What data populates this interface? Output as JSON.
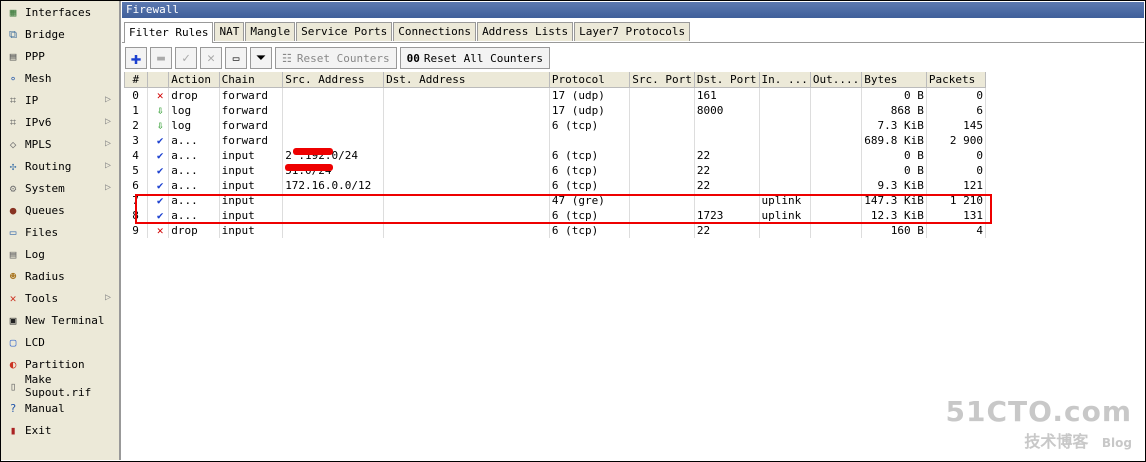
{
  "sidebar": {
    "items": [
      {
        "label": "Interfaces",
        "icon": "interfaces-icon",
        "arrow": false
      },
      {
        "label": "Bridge",
        "icon": "bridge-icon",
        "arrow": false
      },
      {
        "label": "PPP",
        "icon": "ppp-icon",
        "arrow": false
      },
      {
        "label": "Mesh",
        "icon": "mesh-icon",
        "arrow": false
      },
      {
        "label": "IP",
        "icon": "ip-icon",
        "arrow": true
      },
      {
        "label": "IPv6",
        "icon": "ipv6-icon",
        "arrow": true
      },
      {
        "label": "MPLS",
        "icon": "mpls-icon",
        "arrow": true
      },
      {
        "label": "Routing",
        "icon": "routing-icon",
        "arrow": true
      },
      {
        "label": "System",
        "icon": "system-icon",
        "arrow": true
      },
      {
        "label": "Queues",
        "icon": "queues-icon",
        "arrow": false
      },
      {
        "label": "Files",
        "icon": "files-icon",
        "arrow": false
      },
      {
        "label": "Log",
        "icon": "log-icon",
        "arrow": false
      },
      {
        "label": "Radius",
        "icon": "radius-icon",
        "arrow": false
      },
      {
        "label": "Tools",
        "icon": "tools-icon",
        "arrow": true
      },
      {
        "label": "New Terminal",
        "icon": "terminal-icon",
        "arrow": false
      },
      {
        "label": "LCD",
        "icon": "lcd-icon",
        "arrow": false
      },
      {
        "label": "Partition",
        "icon": "partition-icon",
        "arrow": false
      },
      {
        "label": "Make Supout.rif",
        "icon": "supout-icon",
        "arrow": false
      },
      {
        "label": "Manual",
        "icon": "manual-icon",
        "arrow": false
      },
      {
        "label": "Exit",
        "icon": "exit-icon",
        "arrow": false
      }
    ]
  },
  "window": {
    "title": "Firewall"
  },
  "tabs": [
    "Filter Rules",
    "NAT",
    "Mangle",
    "Service Ports",
    "Connections",
    "Address Lists",
    "Layer7 Protocols"
  ],
  "toolbar": {
    "reset_counters": "Reset Counters",
    "reset_all_counters": "Reset All Counters",
    "reset_all_prefix": "00"
  },
  "columns": [
    "#",
    "Action",
    "Chain",
    "Src. Address",
    "Dst. Address",
    "Protocol",
    "Src. Port",
    "Dst. Port",
    "In. ...",
    "Out....",
    "Bytes",
    "Packets"
  ],
  "rows": [
    {
      "n": "0",
      "action_icon": "x",
      "action": "drop",
      "chain": "forward",
      "src": "",
      "dst": "",
      "proto": "17 (udp)",
      "sport": "",
      "dport": "161",
      "in": "",
      "out": "",
      "bytes": "0 B",
      "packets": "0"
    },
    {
      "n": "1",
      "action_icon": "down",
      "action": "log",
      "chain": "forward",
      "src": "",
      "dst": "",
      "proto": "17 (udp)",
      "sport": "",
      "dport": "8000",
      "in": "",
      "out": "",
      "bytes": "868 B",
      "packets": "6"
    },
    {
      "n": "2",
      "action_icon": "down",
      "action": "log",
      "chain": "forward",
      "src": "",
      "dst": "",
      "proto": "6 (tcp)",
      "sport": "",
      "dport": "",
      "in": "",
      "out": "",
      "bytes": "7.3 KiB",
      "packets": "145"
    },
    {
      "n": "3",
      "action_icon": "check",
      "action": "a...",
      "chain": "forward",
      "src": "",
      "dst": "",
      "proto": "",
      "sport": "",
      "dport": "",
      "in": "",
      "out": "",
      "bytes": "689.8 KiB",
      "packets": "2 900"
    },
    {
      "n": "4",
      "action_icon": "check",
      "action": "a...",
      "chain": "input",
      "src": "2 .192.0/24",
      "dst": "",
      "proto": "6 (tcp)",
      "sport": "",
      "dport": "22",
      "in": "",
      "out": "",
      "bytes": "0 B",
      "packets": "0"
    },
    {
      "n": "5",
      "action_icon": "check",
      "action": "a...",
      "chain": "input",
      "src": "51.0/24",
      "dst": "",
      "proto": "6 (tcp)",
      "sport": "",
      "dport": "22",
      "in": "",
      "out": "",
      "bytes": "0 B",
      "packets": "0"
    },
    {
      "n": "6",
      "action_icon": "check",
      "action": "a...",
      "chain": "input",
      "src": "172.16.0.0/12",
      "dst": "",
      "proto": "6 (tcp)",
      "sport": "",
      "dport": "22",
      "in": "",
      "out": "",
      "bytes": "9.3 KiB",
      "packets": "121"
    },
    {
      "n": "7",
      "action_icon": "check",
      "action": "a...",
      "chain": "input",
      "src": "",
      "dst": "",
      "proto": "47 (gre)",
      "sport": "",
      "dport": "",
      "in": "uplink",
      "out": "",
      "bytes": "147.3 KiB",
      "packets": "1 210"
    },
    {
      "n": "8",
      "action_icon": "check",
      "action": "a...",
      "chain": "input",
      "src": "",
      "dst": "",
      "proto": "6 (tcp)",
      "sport": "",
      "dport": "1723",
      "in": "uplink",
      "out": "",
      "bytes": "12.3 KiB",
      "packets": "131"
    },
    {
      "n": "9",
      "action_icon": "x",
      "action": "drop",
      "chain": "input",
      "src": "",
      "dst": "",
      "proto": "6 (tcp)",
      "sport": "",
      "dport": "22",
      "in": "",
      "out": "",
      "bytes": "160 B",
      "packets": "4"
    }
  ],
  "watermark": {
    "line1": "51CTO.com",
    "line2": "技术博客",
    "line3": "Blog"
  },
  "colors": {
    "title_bar": "#4a6aa5",
    "highlight": "#e00000",
    "accent_blue": "#1a3fcf",
    "drop_red": "#d00000",
    "log_green": "#2a9a2a"
  }
}
